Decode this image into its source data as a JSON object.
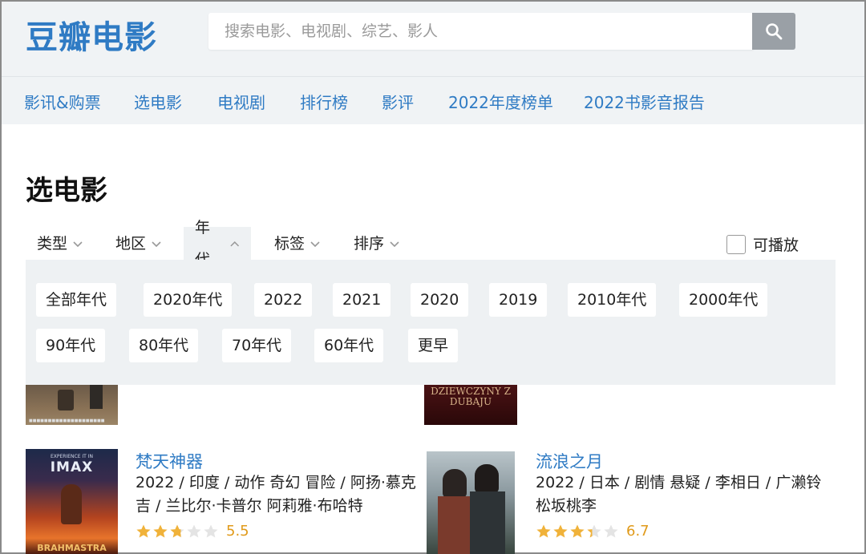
{
  "header": {
    "logo": "豆瓣电影",
    "search_placeholder": "搜索电影、电视剧、综艺、影人"
  },
  "nav": {
    "items": [
      "影讯&购票",
      "选电影",
      "电视剧",
      "排行榜",
      "影评",
      "2022年度榜单",
      "2022书影音报告"
    ]
  },
  "page": {
    "title": "选电影"
  },
  "filters": {
    "tabs": [
      "类型",
      "地区",
      "年代",
      "标签",
      "排序"
    ],
    "active_tab": "年代",
    "playable_label": "可播放",
    "year_options": [
      "全部年代",
      "2020年代",
      "2022",
      "2021",
      "2020",
      "2019",
      "2010年代",
      "2000年代",
      "90年代",
      "80年代",
      "70年代",
      "60年代",
      "更早"
    ]
  },
  "movies": [
    {
      "title": "梵天神器",
      "meta_line1": "2022 / 印度 / 动作 奇幻 冒险 / 阿扬·慕克",
      "meta_line2": "吉 / 兰比尔·卡普尔 阿莉雅·布哈特",
      "rating": "5.5",
      "stars": 2.75,
      "poster_text_top": "IMAX",
      "poster_text_bottom": "BRAHMASTRA"
    },
    {
      "title": "流浪之月",
      "meta_line1": "2022 / 日本 / 剧情 悬疑 / 李相日 / 广濑铃",
      "meta_line2": "松坂桃李",
      "rating": "6.7",
      "stars": 3.35
    }
  ],
  "partial_poster_text": "DZIEWCZYNY Z DUBAJU",
  "colors": {
    "brand": "#2f7bc4",
    "star": "#f0b23a",
    "rating": "#e09a1a"
  }
}
